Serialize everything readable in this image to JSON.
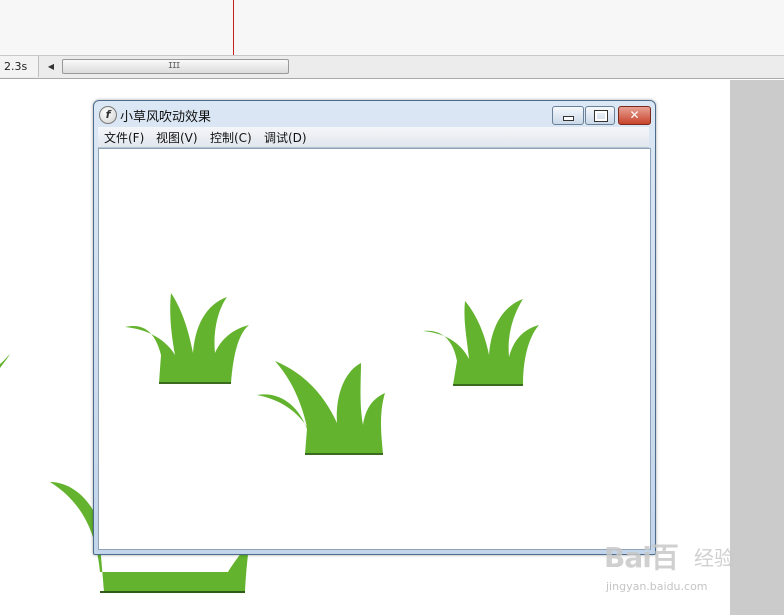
{
  "timeline": {
    "time_label": "2.3s",
    "scroll_left_glyph": "◀",
    "thumb_grip": "III"
  },
  "window": {
    "icon_glyph": "f",
    "title": "小草风吹动效果",
    "close_glyph": "✕"
  },
  "menu": {
    "items": [
      "文件(F)",
      "视图(V)",
      "控制(C)",
      "调试(D)"
    ]
  },
  "colors": {
    "grass": "#63b32e",
    "grass_base": "#3a6b1e"
  },
  "watermark": {
    "logo": "Bai百",
    "text_cn": "经验",
    "url": "jingyan.baidu.com"
  }
}
